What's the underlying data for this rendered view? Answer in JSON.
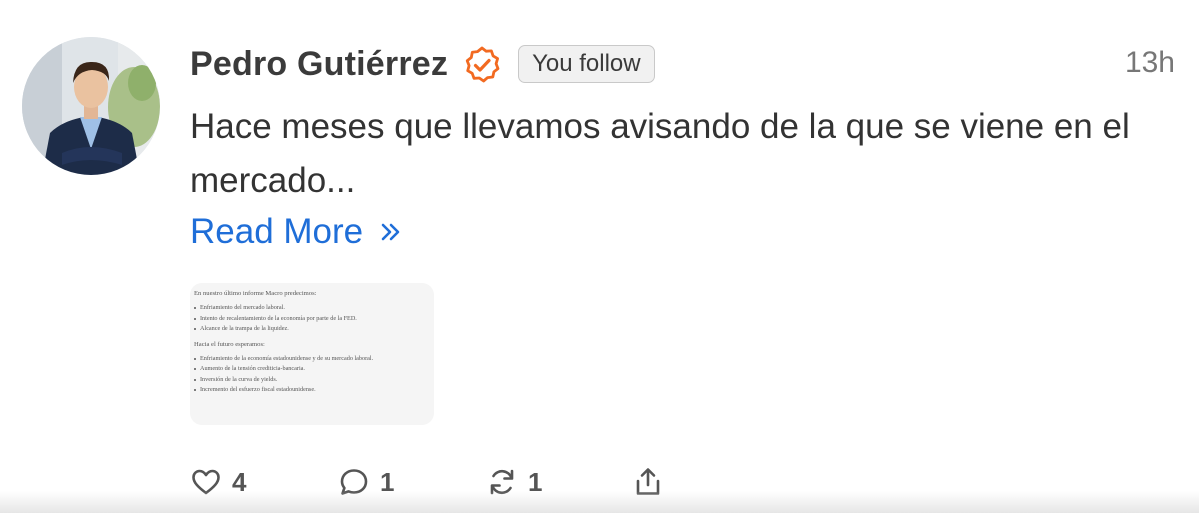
{
  "post": {
    "author": {
      "name": "Pedro Gutiérrez",
      "avatar_icon": "author-avatar",
      "verified_icon": "verified-check-icon",
      "follow_badge": "You follow"
    },
    "timestamp": "13h",
    "text": "Hace meses que llevamos avisando de la que se viene en el mercado...",
    "read_more": {
      "label": "Read More",
      "icon": "double-chevron-right-icon"
    },
    "attachment": {
      "intro": "En nuestro último informe Macro predecimos:",
      "predictions": [
        "Enfriamiento del mercado laboral.",
        "Intento de recalentamiento de la economía por parte de la FED.",
        "Alcance de la trampa de la liquidez."
      ],
      "future_heading": "Hacia el futuro esperamos:",
      "expectations": [
        "Enfriamiento de la economía estadounidense y de su mercado laboral.",
        "Aumento de la tensión crediticia-bancaria.",
        "Inversión de la curva de yields.",
        "Incremento del esfuerzo fiscal estadounidense."
      ]
    },
    "actions": {
      "likes": "4",
      "comments": "1",
      "restacks": "1",
      "icons": [
        "heart-icon",
        "comment-icon",
        "restack-icon",
        "share-icon"
      ]
    }
  },
  "colors": {
    "accent_link": "#1f6ed8",
    "verified_orange": "#f26a21",
    "text": "#333333",
    "muted": "#777777"
  }
}
